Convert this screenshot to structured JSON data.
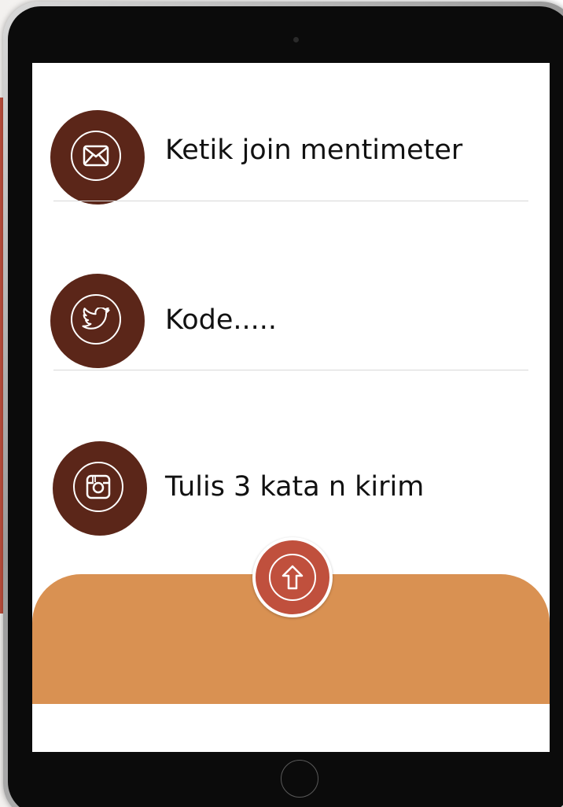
{
  "rows": [
    {
      "icon": "mail-icon",
      "label": "Ketik join mentimeter"
    },
    {
      "icon": "twitter-icon",
      "label": "Kode....."
    },
    {
      "icon": "instagram-icon",
      "label": "Tulis 3 kata n kirim"
    }
  ],
  "footer": {
    "button_icon": "arrow-up-icon"
  },
  "colors": {
    "accent": "#c0503d",
    "icon_circle": "#5b2619",
    "footer_panel": "#d99152",
    "bezel": "#0b0b0b"
  }
}
